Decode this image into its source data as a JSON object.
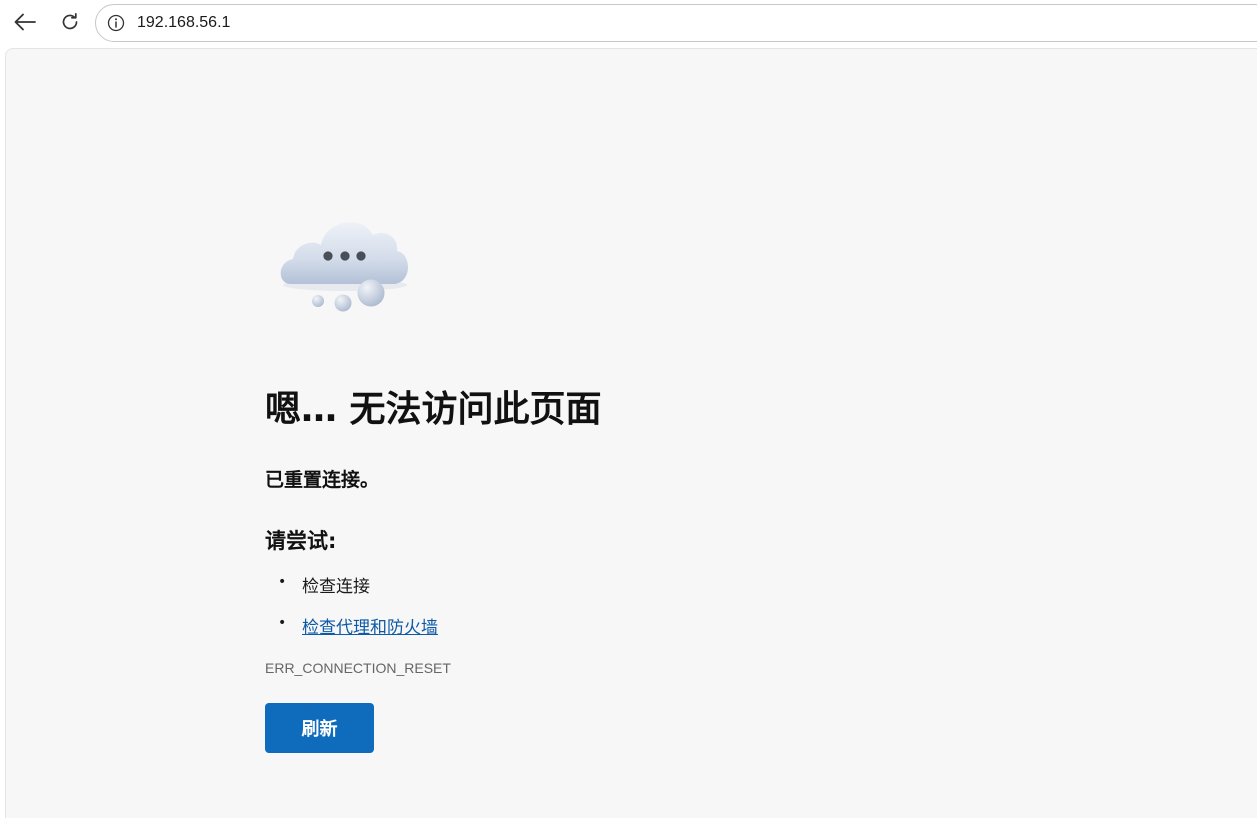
{
  "browser": {
    "url": "192.168.56.1"
  },
  "icons": {
    "back": "back-arrow-icon",
    "reload": "reload-icon",
    "site_info": "info-icon",
    "illustration": "cloud-illustration-icon"
  },
  "error_page": {
    "heading": "嗯… 无法访问此页面",
    "subheading": "已重置连接。",
    "try_heading": "请尝试:",
    "suggestions": [
      {
        "text": "检查连接",
        "is_link": false
      },
      {
        "text": "检查代理和防火墙",
        "is_link": true
      }
    ],
    "error_code": "ERR_CONNECTION_RESET",
    "refresh_label": "刷新"
  },
  "colors": {
    "page_background": "#f7f7f7",
    "accent": "#0f6cbd",
    "link": "#0f5aa6",
    "heading_text": "#111111",
    "muted_text": "#666666"
  }
}
